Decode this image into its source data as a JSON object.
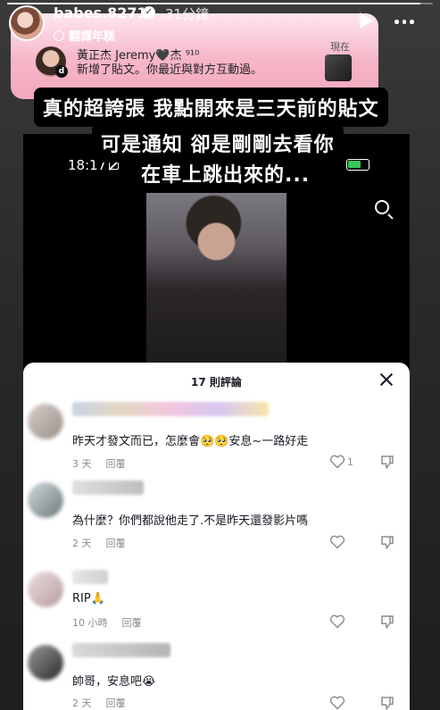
{
  "story": {
    "username": "babes.8271",
    "time_ago": "31分鐘",
    "translate_label": "翻譯年糕",
    "progress": 0.97
  },
  "notification": {
    "sender": "黃正杰 Jeremy🖤杰 ⁹¹⁰",
    "message": "新增了貼文。你最近與對方互動過。",
    "time": "現在",
    "app_badge": "d"
  },
  "captions": [
    "真的超誇張 我點開來是三天前的貼文",
    "可是通知 卻是剛剛去看你",
    "在車上跳出來的..."
  ],
  "phone": {
    "status_time": "18:17"
  },
  "comments_sheet": {
    "title": "17 則評論",
    "reply_label": "回覆",
    "comments": [
      {
        "text": "昨天才發文而已，怎麼會🥺🥺安息~一路好走",
        "time": "3 天",
        "likes": "1"
      },
      {
        "text": "為什麼？你們都說他走了.不是昨天還發影片嗎",
        "time": "2 天",
        "likes": ""
      },
      {
        "text": "RIP🙏",
        "time": "10 小時",
        "likes": ""
      },
      {
        "text": "帥哥，安息吧😭",
        "time": "2 天",
        "likes": ""
      }
    ]
  },
  "colors": {
    "notification_pink": "#f6b6c8",
    "sheet_bg": "#ffffff",
    "meta_gray": "#8a8b91",
    "battery_green": "#35c759"
  }
}
